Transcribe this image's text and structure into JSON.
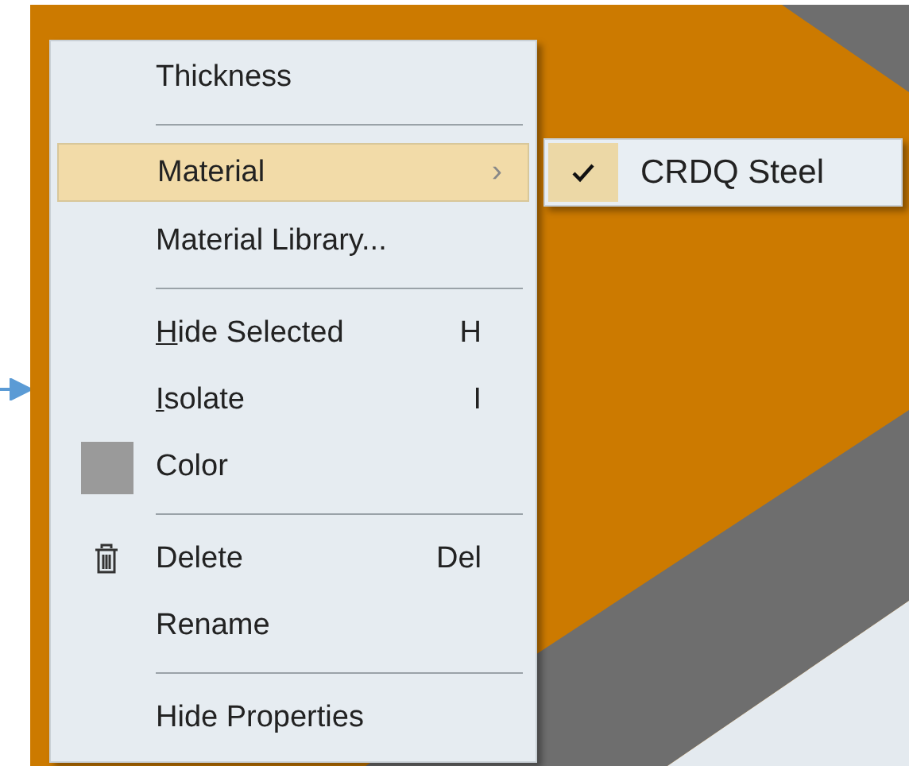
{
  "context_menu": {
    "items": [
      {
        "kind": "item",
        "label": "Thickness",
        "selected": false
      },
      {
        "kind": "separator"
      },
      {
        "kind": "submenu",
        "label": "Material",
        "arrow": "›",
        "selected": true
      },
      {
        "kind": "item",
        "label": "Material Library...",
        "selected": false
      },
      {
        "kind": "separator"
      },
      {
        "kind": "item",
        "label": "Hide Selected",
        "shortcut": "H",
        "mnemonic": true,
        "selected": false
      },
      {
        "kind": "item",
        "label": "Isolate",
        "shortcut": "I",
        "mnemonic": true,
        "selected": false
      },
      {
        "kind": "color",
        "label": "Color",
        "color": "#9a9a9a",
        "selected": false
      },
      {
        "kind": "separator"
      },
      {
        "kind": "delete",
        "label": "Delete",
        "shortcut": "Del",
        "selected": false
      },
      {
        "kind": "item",
        "label": "Rename",
        "selected": false
      },
      {
        "kind": "separator"
      },
      {
        "kind": "item",
        "label": "Hide Properties",
        "selected": false
      }
    ]
  },
  "submenu": {
    "items": [
      {
        "label": "CRDQ Steel",
        "checked": true
      }
    ]
  }
}
